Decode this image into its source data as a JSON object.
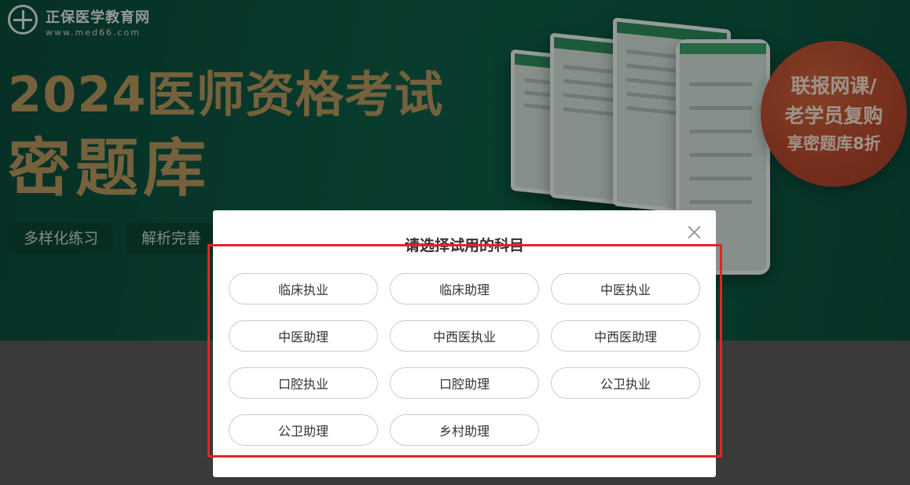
{
  "brand": {
    "name": "正保医学教育网",
    "url": "www.med66.com"
  },
  "banner": {
    "headline": "2024医师资格考试",
    "subheadline": "密题库",
    "features": [
      "多样化练习",
      "解析完善"
    ],
    "promo": {
      "line1": "联报网课/",
      "line2": "老学员复购",
      "line3": "享密题库8折"
    }
  },
  "modal": {
    "title": "请选择试用的科目",
    "options": [
      "临床执业",
      "临床助理",
      "中医执业",
      "中医助理",
      "中西医执业",
      "中西医助理",
      "口腔执业",
      "口腔助理",
      "公卫执业",
      "公卫助理",
      "乡村助理"
    ]
  },
  "colors": {
    "banner_green": "#0e5d47",
    "headline_gold": "#b4955c",
    "promo_red": "#b4472d",
    "highlight_red": "#e32424"
  }
}
